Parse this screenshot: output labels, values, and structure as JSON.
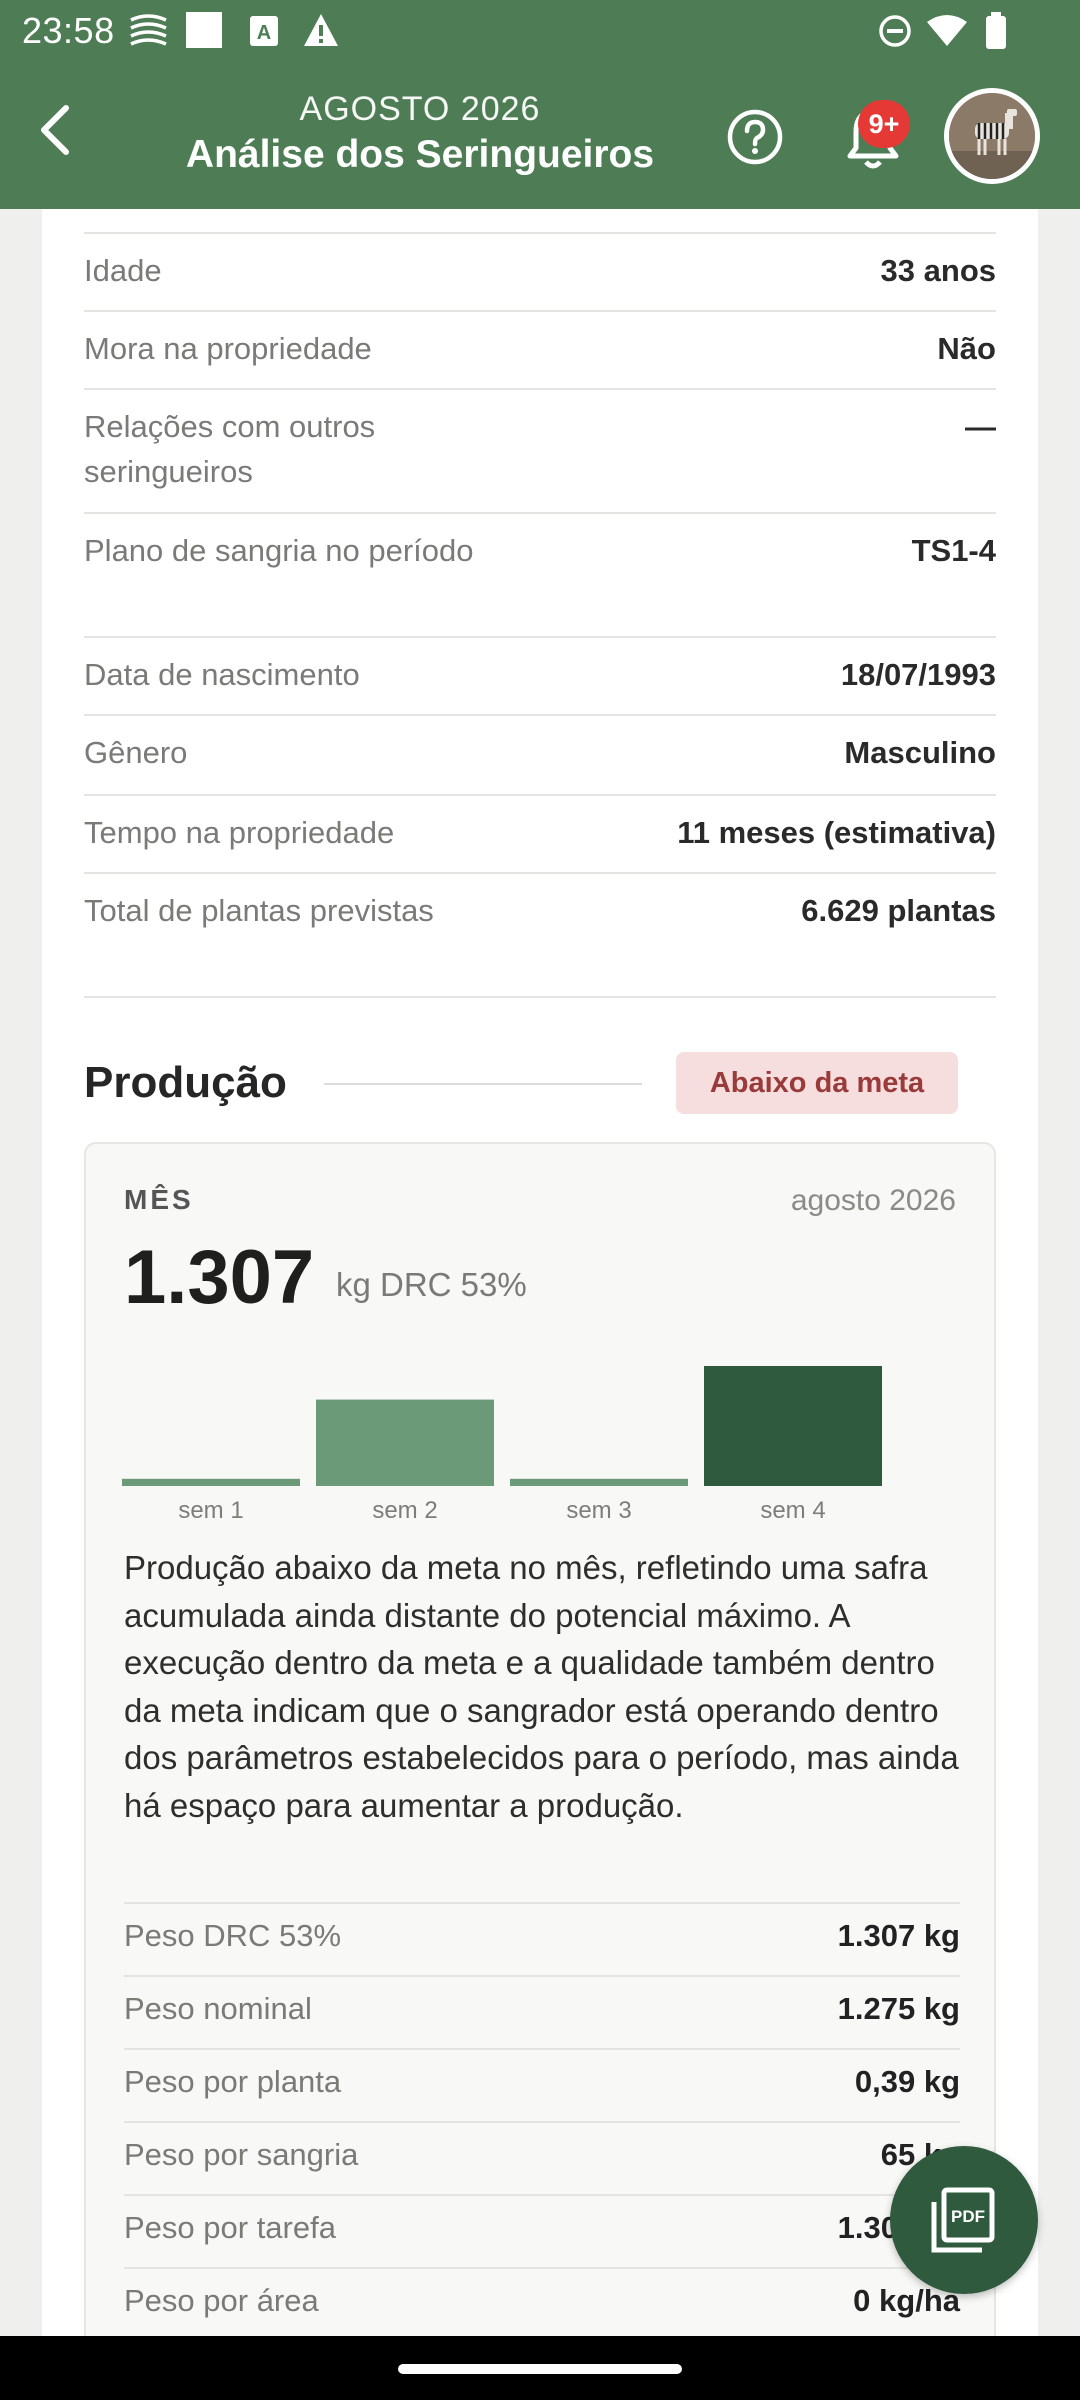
{
  "status_bar": {
    "time": "23:58"
  },
  "app_bar": {
    "subtitle": "AGOSTO 2026",
    "title": "Análise dos Seringueiros",
    "notification_count": "9+"
  },
  "profile_rows": [
    {
      "label": "Idade",
      "value": "33 anos"
    },
    {
      "label": "Mora na propriedade",
      "value": "Não"
    },
    {
      "label": "Relações com outros seringueiros",
      "value": "—"
    },
    {
      "label": "Plano de sangria no período",
      "value": "TS1-4"
    },
    {
      "label": "Data de nascimento",
      "value": "18/07/1993"
    },
    {
      "label": "Gênero",
      "value": "Masculino"
    },
    {
      "label": "Tempo na propriedade",
      "value": "11 meses (estimativa)"
    },
    {
      "label": "Total de plantas previstas",
      "value": "6.629 plantas"
    }
  ],
  "production": {
    "title": "Produção",
    "status_badge": "Abaixo da meta",
    "period_label": "MÊS",
    "period_value": "agosto 2026",
    "total": "1.307",
    "unit": "kg DRC 53%",
    "description": "Produção abaixo da meta no mês, refletindo uma safra acumulada ainda distante do potencial máximo. A execução dentro da meta e a qualidade também dentro da meta indicam que o sangrador está operando dentro dos parâmetros estabelecidos para o período, mas ainda há espaço para aumentar a produção.",
    "metrics": [
      {
        "label": "Peso DRC 53%",
        "value": "1.307 kg"
      },
      {
        "label": "Peso nominal",
        "value": "1.275 kg"
      },
      {
        "label": "Peso por planta",
        "value": "0,39 kg"
      },
      {
        "label": "Peso por sangria",
        "value": "65 kg"
      },
      {
        "label": "Peso por tarefa",
        "value": "1.307 kg"
      },
      {
        "label": "Peso por área",
        "value": "0 kg/ha"
      }
    ]
  },
  "chart_data": {
    "type": "bar",
    "categories": [
      "sem 1",
      "sem 2",
      "sem 3",
      "sem 4"
    ],
    "values": [
      0.06,
      0.72,
      0.06,
      1.0
    ],
    "colors": [
      "#6a9a78",
      "#6a9a78",
      "#6a9a78",
      "#2f5a3e"
    ],
    "xlabel": "",
    "ylabel": ""
  },
  "colors": {
    "header": "#4e7d55",
    "accent_dark": "#2f5a3e",
    "badge_bg": "#f6dede",
    "badge_text": "#9a3a3a"
  }
}
